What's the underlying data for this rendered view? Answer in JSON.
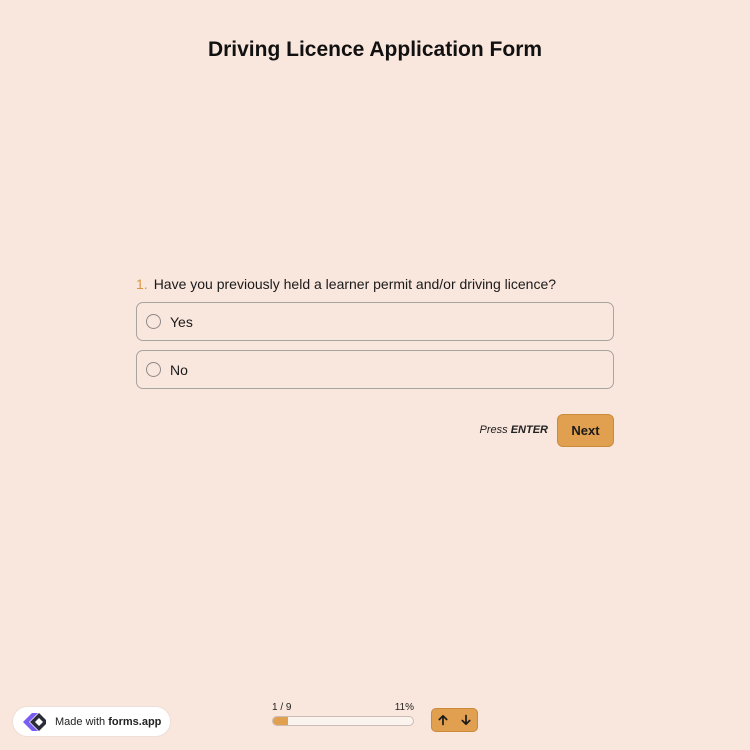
{
  "form": {
    "title": "Driving Licence Application Form"
  },
  "question": {
    "number": "1.",
    "text": "Have you previously held a learner permit and/or driving licence?",
    "options": [
      {
        "label": "Yes"
      },
      {
        "label": "No"
      }
    ]
  },
  "actions": {
    "press_prefix": "Press",
    "press_key": "ENTER",
    "next_label": "Next"
  },
  "progress": {
    "counter": "1 / 9",
    "percent_label": "11%",
    "fraction": 0.11
  },
  "branding": {
    "prefix": "Made with",
    "name": "forms.app"
  },
  "colors": {
    "background": "#f9e6dd",
    "accent": "#e0a050",
    "border": "#a8a4a2"
  },
  "icons": {
    "brand_logo": "forms-app-logo",
    "nav_up": "arrow-up-icon",
    "nav_down": "arrow-down-icon"
  }
}
